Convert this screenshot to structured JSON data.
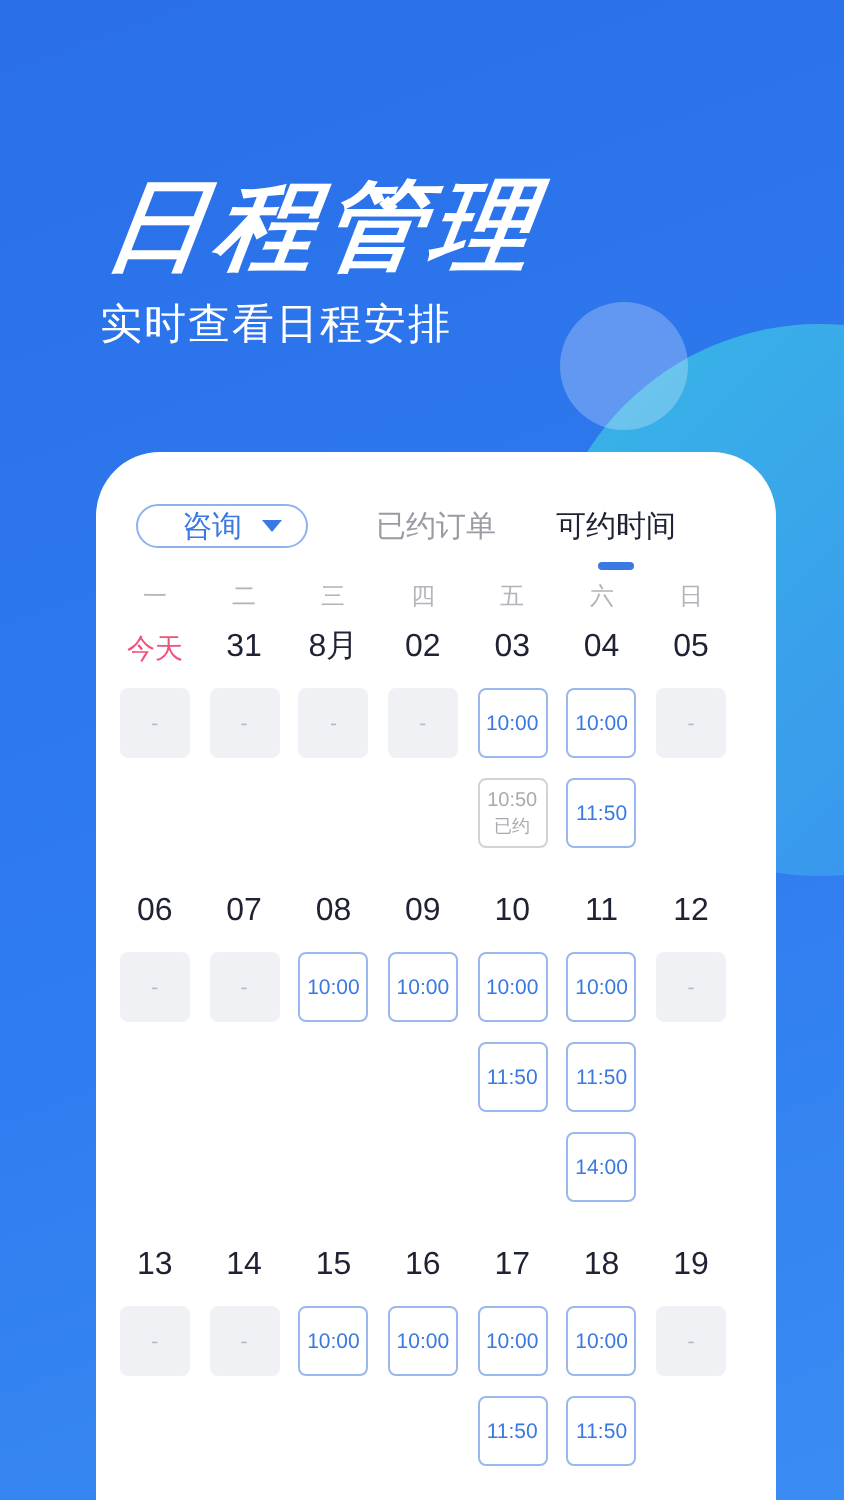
{
  "headline": "日程管理",
  "subtitle": "实时查看日程安排",
  "service_dropdown": {
    "value": "咨询"
  },
  "tabs": [
    {
      "label": "已约订单",
      "selected": false
    },
    {
      "label": "可约时间",
      "selected": true
    }
  ],
  "weekdays": [
    "一",
    "二",
    "三",
    "四",
    "五",
    "六",
    "日"
  ],
  "weeks": [
    {
      "days": [
        {
          "date": "今天",
          "today": true,
          "slots": [
            {
              "kind": "empty",
              "label": "-"
            }
          ]
        },
        {
          "date": "31",
          "today": false,
          "slots": [
            {
              "kind": "empty",
              "label": "-"
            }
          ]
        },
        {
          "date": "8月",
          "today": false,
          "slots": [
            {
              "kind": "empty",
              "label": "-"
            }
          ]
        },
        {
          "date": "02",
          "today": false,
          "slots": [
            {
              "kind": "empty",
              "label": "-"
            }
          ]
        },
        {
          "date": "03",
          "today": false,
          "slots": [
            {
              "kind": "open",
              "label": "10:00"
            },
            {
              "kind": "booked",
              "label": "10:50",
              "note": "已约"
            }
          ]
        },
        {
          "date": "04",
          "today": false,
          "slots": [
            {
              "kind": "open",
              "label": "10:00"
            },
            {
              "kind": "open",
              "label": "11:50"
            }
          ]
        },
        {
          "date": "05",
          "today": false,
          "slots": [
            {
              "kind": "empty",
              "label": "-"
            }
          ]
        }
      ]
    },
    {
      "days": [
        {
          "date": "06",
          "today": false,
          "slots": [
            {
              "kind": "empty",
              "label": "-"
            }
          ]
        },
        {
          "date": "07",
          "today": false,
          "slots": [
            {
              "kind": "empty",
              "label": "-"
            }
          ]
        },
        {
          "date": "08",
          "today": false,
          "slots": [
            {
              "kind": "open",
              "label": "10:00"
            }
          ]
        },
        {
          "date": "09",
          "today": false,
          "slots": [
            {
              "kind": "open",
              "label": "10:00"
            }
          ]
        },
        {
          "date": "10",
          "today": false,
          "slots": [
            {
              "kind": "open",
              "label": "10:00"
            },
            {
              "kind": "open",
              "label": "11:50"
            }
          ]
        },
        {
          "date": "11",
          "today": false,
          "slots": [
            {
              "kind": "open",
              "label": "10:00"
            },
            {
              "kind": "open",
              "label": "11:50"
            },
            {
              "kind": "open",
              "label": "14:00"
            }
          ]
        },
        {
          "date": "12",
          "today": false,
          "slots": [
            {
              "kind": "empty",
              "label": "-"
            }
          ]
        }
      ]
    },
    {
      "days": [
        {
          "date": "13",
          "today": false,
          "slots": [
            {
              "kind": "empty",
              "label": "-"
            }
          ]
        },
        {
          "date": "14",
          "today": false,
          "slots": [
            {
              "kind": "empty",
              "label": "-"
            }
          ]
        },
        {
          "date": "15",
          "today": false,
          "slots": [
            {
              "kind": "open",
              "label": "10:00"
            }
          ]
        },
        {
          "date": "16",
          "today": false,
          "slots": [
            {
              "kind": "open",
              "label": "10:00"
            }
          ]
        },
        {
          "date": "17",
          "today": false,
          "slots": [
            {
              "kind": "open",
              "label": "10:00"
            },
            {
              "kind": "open",
              "label": "11:50"
            }
          ]
        },
        {
          "date": "18",
          "today": false,
          "slots": [
            {
              "kind": "open",
              "label": "10:00"
            },
            {
              "kind": "open",
              "label": "11:50"
            }
          ]
        },
        {
          "date": "19",
          "today": false,
          "slots": [
            {
              "kind": "empty",
              "label": "-"
            }
          ]
        }
      ]
    }
  ]
}
